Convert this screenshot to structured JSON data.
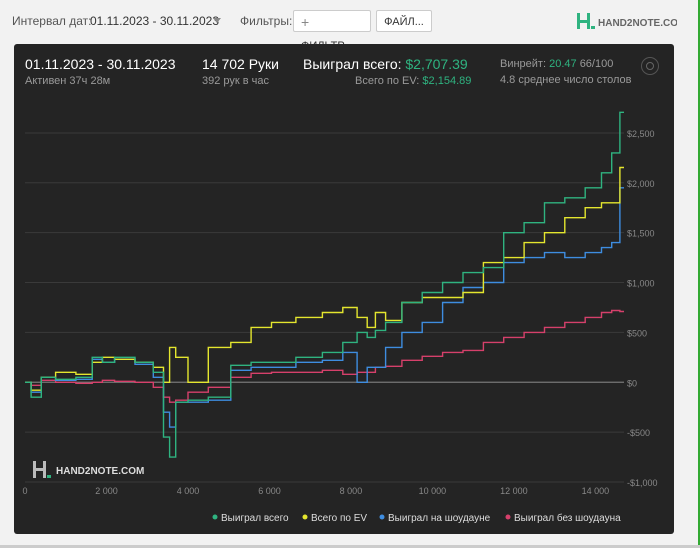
{
  "topbar": {
    "interval_label": "Интервал дат:",
    "date_range": "01.11.2023 - 30.11.2023",
    "filters_label": "Фильтры:",
    "filter_button": "ФИЛЬТР...",
    "file_button": "ФАЙЛ...",
    "brand": "HAND2NOTE.COM"
  },
  "summary": {
    "period": "01.11.2023 - 30.11.2023",
    "active": "Активен 37ч 28м",
    "hands": "14 702 Руки",
    "hands_per_hour": "392 рук в час",
    "won_label": "Выиграл всего:",
    "won_value": "$2,707.39",
    "ev_label": "Всего по EV:",
    "ev_value": "$2,154.89",
    "winrate_label": "Винрейт:",
    "winrate_value": "20.47",
    "winrate_unit": "66/100",
    "tables": "4.8 среднее число столов"
  },
  "chart_data": {
    "type": "line",
    "watermark": "HAND2NOTE.COM",
    "xlim": [
      0,
      14702
    ],
    "ylim": [
      -1000,
      2700
    ],
    "x_ticks": [
      "0",
      "2 000",
      "4 000",
      "6 000",
      "8 000",
      "10 000",
      "12 000",
      "14 000"
    ],
    "x_tick_values": [
      0,
      2000,
      4000,
      6000,
      8000,
      10000,
      12000,
      14000
    ],
    "y_ticks": [
      "$2,500",
      "$2,000",
      "$1,500",
      "$1,000",
      "$500",
      "$0",
      "-$500",
      "-$1,000"
    ],
    "y_tick_values": [
      2500,
      2000,
      1500,
      1000,
      500,
      0,
      -500,
      -1000
    ],
    "legend_position": "bottom",
    "x": [
      0,
      300,
      500,
      1000,
      1500,
      1800,
      2000,
      2400,
      3000,
      3300,
      3500,
      3600,
      3800,
      4200,
      4800,
      5300,
      5800,
      6300,
      7000,
      7600,
      8000,
      8300,
      8500,
      8700,
      9000,
      9500,
      10000,
      10500,
      11000,
      11500,
      12000,
      12500,
      13000,
      13500,
      14000,
      14300,
      14500,
      14702
    ],
    "series": [
      {
        "name": "Выиграл всего",
        "color": "#2fb380",
        "values": [
          0,
          -150,
          50,
          30,
          50,
          250,
          200,
          250,
          200,
          100,
          -550,
          -750,
          -200,
          -180,
          -150,
          170,
          200,
          200,
          250,
          300,
          400,
          500,
          450,
          520,
          600,
          800,
          900,
          1000,
          1100,
          1150,
          1500,
          1600,
          1800,
          1850,
          1950,
          2100,
          2300,
          2707
        ]
      },
      {
        "name": "Всего по EV",
        "color": "#e4e62e",
        "values": [
          0,
          -80,
          50,
          100,
          80,
          200,
          250,
          230,
          200,
          150,
          0,
          350,
          250,
          0,
          350,
          400,
          550,
          600,
          650,
          700,
          750,
          650,
          550,
          700,
          620,
          800,
          850,
          850,
          900,
          1200,
          1250,
          1400,
          1500,
          1650,
          1750,
          1800,
          1800,
          2154
        ]
      },
      {
        "name": "Выиграл на шоудауне",
        "color": "#3e8de0",
        "values": [
          0,
          -100,
          50,
          20,
          30,
          230,
          200,
          230,
          180,
          50,
          -300,
          -450,
          -200,
          -200,
          -180,
          120,
          150,
          150,
          200,
          220,
          300,
          0,
          150,
          150,
          350,
          500,
          600,
          800,
          950,
          1000,
          1200,
          1250,
          1300,
          1250,
          1300,
          1350,
          1400,
          1950
        ]
      },
      {
        "name": "Выиграл без шоудауна",
        "color": "#d6406b",
        "values": [
          0,
          -30,
          20,
          0,
          -10,
          0,
          20,
          10,
          0,
          -50,
          -150,
          -200,
          -180,
          -100,
          -50,
          50,
          90,
          100,
          100,
          120,
          80,
          100,
          100,
          150,
          160,
          220,
          260,
          300,
          320,
          400,
          450,
          500,
          550,
          600,
          650,
          700,
          720,
          710
        ]
      }
    ]
  }
}
